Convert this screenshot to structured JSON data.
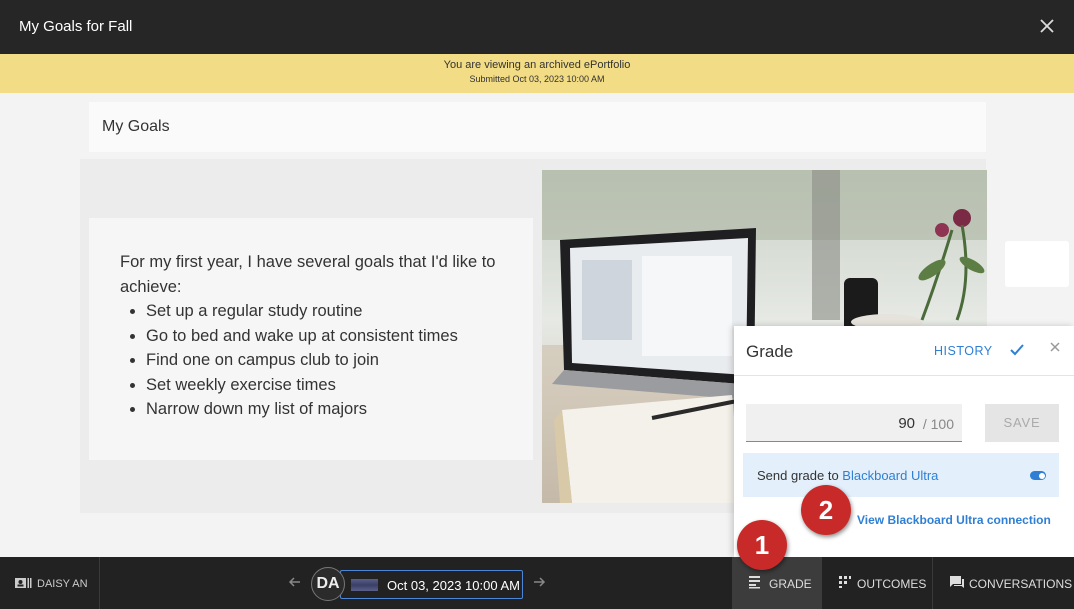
{
  "window": {
    "title": "My Goals for Fall"
  },
  "banner": {
    "line1": "You are viewing an archived ePortfolio",
    "line2": "Submitted Oct 03, 2023 10:00 AM"
  },
  "page": {
    "heading": "My Goals",
    "intro": "For my first year, I have several goals that I'd like to achieve:",
    "goals": [
      "Set up a regular study routine",
      "Go to bed and wake up at consistent times",
      "Find one on campus club to join",
      "Set weekly exercise times",
      "Narrow down my list of majors"
    ]
  },
  "grade_panel": {
    "title": "Grade",
    "history_label": "HISTORY",
    "score": "90",
    "max_score": "/ 100",
    "save_label": "SAVE",
    "send_prefix": "Send grade to ",
    "send_link": "Blackboard Ultra",
    "send_enabled": true,
    "view_connection_label": "View Blackboard Ultra connection"
  },
  "footer": {
    "user_name": "DAISY AN",
    "avatar_initials": "DA",
    "submission_date": "Oct 03, 2023 10:00 AM",
    "tabs": {
      "grade": "GRADE",
      "outcomes": "OUTCOMES",
      "conversations": "CONVERSATIONS"
    }
  },
  "markers": {
    "one": "1",
    "two": "2"
  },
  "colors": {
    "accent": "#2f7fd4",
    "banner": "#f2dc85",
    "marker": "#c82a2a"
  },
  "icons": {
    "close": "close-icon",
    "check": "check-icon",
    "grade": "grade-list-icon",
    "outcomes": "outcomes-icon",
    "conversations": "chat-icon",
    "user": "id-card-icon"
  }
}
